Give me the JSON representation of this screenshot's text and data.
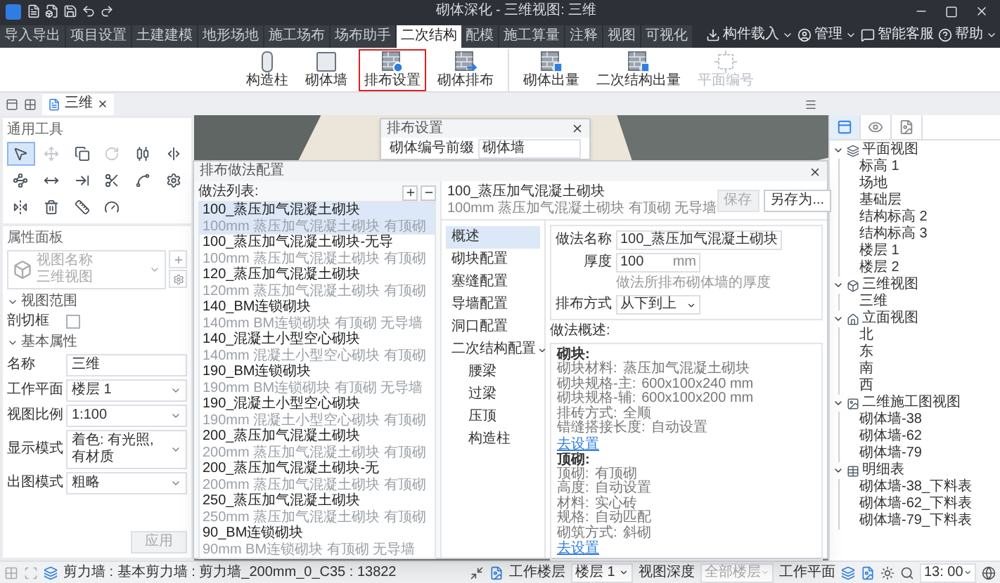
{
  "window": {
    "title": "砌体深化 - 三维视图: 三维"
  },
  "menu_tabs": [
    {
      "label": "导入导出",
      "selected": false
    },
    {
      "label": "项目设置",
      "selected": false
    },
    {
      "label": "土建建模",
      "selected": false
    },
    {
      "label": "地形场地",
      "selected": false
    },
    {
      "label": "施工场布",
      "selected": false
    },
    {
      "label": "场布助手",
      "selected": false
    },
    {
      "label": "二次结构",
      "selected": true
    },
    {
      "label": "配模",
      "selected": false
    },
    {
      "label": "施工算量",
      "selected": false
    },
    {
      "label": "注释",
      "selected": false
    },
    {
      "label": "视图",
      "selected": false
    },
    {
      "label": "可视化",
      "selected": false
    }
  ],
  "header_actions": [
    {
      "kind": "import",
      "label": "构件载入",
      "dropdown": true
    },
    {
      "kind": "manage",
      "label": "管理",
      "dropdown": true
    },
    {
      "kind": "service",
      "label": "智能客服",
      "dropdown": false
    },
    {
      "kind": "help",
      "label": "帮助",
      "dropdown": true
    }
  ],
  "ribbon": {
    "groups": [
      [
        {
          "kind": "column",
          "label": "构造柱",
          "selected": false,
          "disabled": false
        },
        {
          "kind": "wall",
          "label": "砌体墙",
          "selected": false,
          "disabled": false
        },
        {
          "kind": "layout_settings",
          "label": "排布设置",
          "selected": true,
          "disabled": false
        },
        {
          "kind": "layout",
          "label": "砌体排布",
          "selected": false,
          "disabled": false
        }
      ],
      [
        {
          "kind": "wall_quantity",
          "label": "砌体出量",
          "selected": false,
          "disabled": false
        },
        {
          "kind": "structure_quantity",
          "label": "二次结构出量",
          "selected": false,
          "disabled": false
        },
        {
          "kind": "plan_number",
          "label": "平面编号",
          "selected": false,
          "disabled": true
        }
      ]
    ]
  },
  "view_tabs": [
    {
      "label": "三维",
      "selected": true
    }
  ],
  "tools_panel": {
    "title": "通用工具",
    "tools": [
      {
        "kind": "pointer",
        "selected": true,
        "disabled": false
      },
      {
        "kind": "move",
        "selected": false,
        "disabled": true
      },
      {
        "kind": "copy",
        "selected": false,
        "disabled": false
      },
      {
        "kind": "rotate",
        "selected": false,
        "disabled": true
      },
      {
        "kind": "align",
        "selected": false,
        "disabled": false
      },
      {
        "kind": "split",
        "selected": false,
        "disabled": false
      },
      {
        "kind": "offset",
        "selected": false,
        "disabled": false
      },
      {
        "kind": "dimension",
        "selected": false,
        "disabled": false
      },
      {
        "kind": "extend",
        "selected": false,
        "disabled": false
      },
      {
        "kind": "trim",
        "selected": false,
        "disabled": false
      },
      {
        "kind": "connect",
        "selected": false,
        "disabled": false
      },
      {
        "kind": "settings",
        "selected": false,
        "disabled": false
      },
      {
        "kind": "mirror",
        "selected": false,
        "disabled": false
      },
      {
        "kind": "delete",
        "selected": false,
        "disabled": false
      },
      {
        "kind": "measure",
        "selected": false,
        "disabled": false
      },
      {
        "kind": "gauge",
        "selected": false,
        "disabled": false
      }
    ]
  },
  "properties_panel": {
    "title": "属性面板",
    "type_name": "视图名称",
    "type_value": "三维视图",
    "sections": [
      {
        "title": "视图范围",
        "expanded": true,
        "fields": [
          {
            "kind": "checkbox",
            "label": "剖切框",
            "checked": false
          }
        ]
      },
      {
        "title": "基本属性",
        "expanded": true,
        "fields": [
          {
            "kind": "text",
            "label": "名称",
            "value": "三维"
          },
          {
            "kind": "select",
            "label": "工作平面",
            "value": "楼层 1"
          },
          {
            "kind": "select",
            "label": "视图比例",
            "value": "1:100"
          },
          {
            "kind": "select",
            "label": "显示模式",
            "value": "着色: 有光照, 有材质"
          },
          {
            "kind": "select",
            "label": "出图模式",
            "value": "粗略"
          }
        ]
      }
    ],
    "apply_button": {
      "label": "应用",
      "disabled": true
    }
  },
  "layout_dialog": {
    "title": "排布设置",
    "field_label": "砌体编号前缀",
    "field_value": "砌体墙"
  },
  "method_dialog": {
    "title": "排布做法配置",
    "list_label": "做法列表:",
    "methods": [
      {
        "name": "100_蒸压加气混凝土砌块",
        "summary": "100mm 蒸压加气混凝土砌块 有顶砌",
        "selected": true
      },
      {
        "name": "100_蒸压加气混凝土砌块-无导",
        "summary": "100mm 蒸压加气混凝土砌块 有顶砌",
        "selected": false
      },
      {
        "name": "120_蒸压加气混凝土砌块",
        "summary": "120mm 蒸压加气混凝土砌块 有顶砌",
        "selected": false
      },
      {
        "name": "140_BM连锁砌块",
        "summary": "140mm BM连锁砌块 有顶砌 无导墙",
        "selected": false
      },
      {
        "name": "140_混凝土小型空心砌块",
        "summary": "140mm 混凝土小型空心砌块 有顶砌",
        "selected": false
      },
      {
        "name": "190_BM连锁砌块",
        "summary": "190mm BM连锁砌块 有顶砌 无导墙",
        "selected": false
      },
      {
        "name": "190_混凝土小型空心砌块",
        "summary": "190mm 混凝土小型空心砌块 有顶砌",
        "selected": false
      },
      {
        "name": "200_蒸压加气混凝土砌块",
        "summary": "200mm 蒸压加气混凝土砌块 有顶砌",
        "selected": false
      },
      {
        "name": "200_蒸压加气混凝土砌块-无",
        "summary": "200mm 蒸压加气混凝土砌块 有顶砌",
        "selected": false
      },
      {
        "name": "250_蒸压加气混凝土砌块",
        "summary": "250mm 蒸压加气混凝土砌块 有顶砌",
        "selected": false
      },
      {
        "name": "90_BM连锁砌块",
        "summary": "90mm BM连锁砌块 有顶砌 无导墙",
        "selected": false
      }
    ],
    "header": {
      "name": "100_蒸压加气混凝土砌块",
      "summary": "100mm 蒸压加气混凝土砌块 有顶砌 无导墙"
    },
    "buttons": [
      {
        "label": "保存",
        "disabled": true
      },
      {
        "label": "另存为...",
        "disabled": false
      }
    ],
    "nav": [
      {
        "label": "概述",
        "selected": true
      },
      {
        "label": "砌块配置",
        "selected": false
      },
      {
        "label": "塞缝配置",
        "selected": false
      },
      {
        "label": "导墙配置",
        "selected": false
      },
      {
        "label": "洞口配置",
        "selected": false
      },
      {
        "label": "二次结构配置",
        "selected": false,
        "expanded": true,
        "children": [
          {
            "label": "腰梁",
            "selected": false
          },
          {
            "label": "过梁",
            "selected": false
          },
          {
            "label": "压顶",
            "selected": false
          },
          {
            "label": "构造柱",
            "selected": false
          }
        ]
      }
    ],
    "form": {
      "name_label": "做法名称",
      "name_value": "100_蒸压加气混凝土砌块",
      "thickness_label": "厚度",
      "thickness_value": "100",
      "thickness_unit": "mm",
      "thickness_hint": "做法所排布砌体墙的厚度",
      "order_label": "排布方式",
      "order_value": "从下到上"
    },
    "overview_label": "做法概述:",
    "overview": [
      {
        "heading": "砌块:",
        "lines": [
          {
            "label": "砌块材料:",
            "value": "蒸压加气混凝土砌块"
          },
          {
            "label": "砌块规格-主:",
            "value": "600x100x240 mm"
          },
          {
            "label": "砌块规格-辅:",
            "value": "600x100x200 mm"
          },
          {
            "label": "排砖方式:",
            "value": "全顺"
          },
          {
            "label": "错缝搭接长度:",
            "value": "自动设置"
          }
        ],
        "link": "去设置"
      },
      {
        "heading": "顶砌:",
        "lines": [
          {
            "label": "顶砌:",
            "value": "有顶砌"
          },
          {
            "label": "高度:",
            "value": "自动设置"
          },
          {
            "label": "材料:",
            "value": "实心砖"
          },
          {
            "label": "规格:",
            "value": "自动匹配"
          },
          {
            "label": "砌筑方式:",
            "value": "斜砌"
          }
        ],
        "link": "去设置"
      }
    ]
  },
  "project_tree": {
    "tabs": [
      {
        "kind": "browser",
        "selected": true
      },
      {
        "kind": "layers",
        "selected": false
      },
      {
        "kind": "sheets",
        "selected": false
      }
    ],
    "items": [
      {
        "kind": "plan",
        "label": "平面视图",
        "expanded": true,
        "children": [
          {
            "label": "标高 1"
          },
          {
            "label": "场地"
          },
          {
            "label": "基础层"
          },
          {
            "label": "结构标高 2"
          },
          {
            "label": "结构标高 3"
          },
          {
            "label": "楼层 1"
          },
          {
            "label": "楼层 2"
          }
        ]
      },
      {
        "kind": "three_d",
        "label": "三维视图",
        "expanded": true,
        "children": [
          {
            "label": "三维"
          }
        ]
      },
      {
        "kind": "elevation",
        "label": "立面视图",
        "expanded": true,
        "children": [
          {
            "label": "北"
          },
          {
            "label": "东"
          },
          {
            "label": "南"
          },
          {
            "label": "西"
          }
        ]
      },
      {
        "kind": "drawing",
        "label": "二维施工图视图",
        "expanded": true,
        "children": [
          {
            "label": "砌体墙-38"
          },
          {
            "label": "砌体墙-62"
          },
          {
            "label": "砌体墙-79"
          }
        ]
      },
      {
        "kind": "schedule",
        "label": "明细表",
        "expanded": true,
        "children": [
          {
            "label": "砌体墙-38_下料表"
          },
          {
            "label": "砌体墙-62_下料表"
          },
          {
            "label": "砌体墙-79_下料表"
          }
        ]
      }
    ]
  },
  "status_bar": {
    "selection": "剪力墙 : 基本剪力墙 : 剪力墙_200mm_0_C35 : 13822",
    "work_floor_label": "工作楼层",
    "work_floor": "楼层 1",
    "view_depth_label": "视图深度",
    "view_depth": "全部楼层",
    "work_plane_label": "工作平面",
    "time": "13: 00"
  }
}
